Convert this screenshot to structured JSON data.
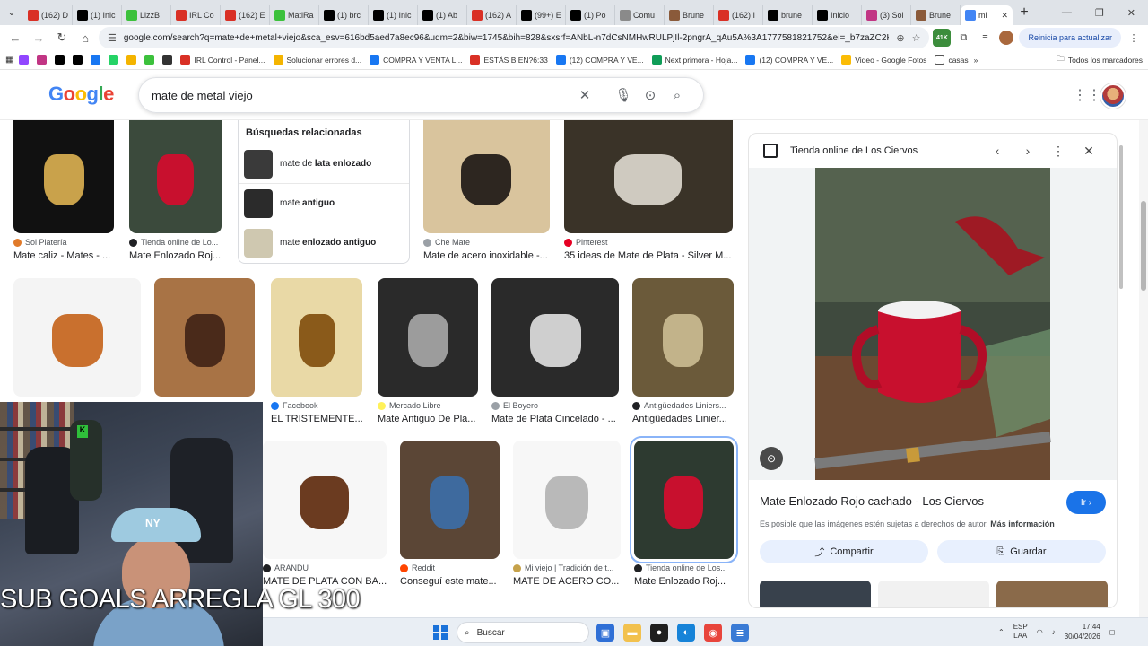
{
  "browser": {
    "tabs": [
      {
        "label": "(162) D",
        "color": "#d93025"
      },
      {
        "label": "(1) Inic",
        "color": "#000000"
      },
      {
        "label": "LizzB",
        "color": "#3cc13c"
      },
      {
        "label": "IRL Co",
        "color": "#d93025"
      },
      {
        "label": "(162) E",
        "color": "#d93025"
      },
      {
        "label": "MatiRa",
        "color": "#3cc13c"
      },
      {
        "label": "(1) brc",
        "color": "#000000"
      },
      {
        "label": "(1) Inic",
        "color": "#000000"
      },
      {
        "label": "(1) Ab",
        "color": "#000000"
      },
      {
        "label": "(162) A",
        "color": "#d93025"
      },
      {
        "label": "(99+) E",
        "color": "#000000"
      },
      {
        "label": "(1) Po",
        "color": "#000000"
      },
      {
        "label": "Comu",
        "color": "#8a8a8a"
      },
      {
        "label": "Brune",
        "color": "#8a5a3a"
      },
      {
        "label": "(162) I",
        "color": "#d93025"
      },
      {
        "label": "brune",
        "color": "#000000"
      },
      {
        "label": "Inicio",
        "color": "#000000"
      },
      {
        "label": "(3) Sol",
        "color": "#c13584"
      },
      {
        "label": "Brune",
        "color": "#8a5a3a"
      },
      {
        "label": "mi",
        "color": "#4285f4",
        "active": true
      }
    ],
    "new_tab": "+",
    "url": "google.com/search?q=mate+de+metal+viejo&sca_esv=616bd5aed7a8ec96&udm=2&biw=1745&bih=828&sxsrf=ANbL-n7dCsNMHwRULPjIl-2pngrA_qAu5A%3A1777581821752&ei=_b7zaZC2KeHd1sQPmbeY4...",
    "ext_badge": "41K",
    "update_button": "Reinicia para actualizar",
    "bookmarks": [
      {
        "label": "",
        "color": "#9146ff"
      },
      {
        "label": "",
        "color": "#c13584"
      },
      {
        "label": "",
        "color": "#000000"
      },
      {
        "label": "",
        "color": "#000000"
      },
      {
        "label": "",
        "color": "#1877f2"
      },
      {
        "label": "",
        "color": "#25d366"
      },
      {
        "label": "",
        "color": "#f4b400"
      },
      {
        "label": "",
        "color": "#3cc13c"
      },
      {
        "label": "",
        "color": "#333333"
      },
      {
        "label": "IRL Control - Panel...",
        "color": "#d93025"
      },
      {
        "label": "Solucionar errores d...",
        "color": "#f4b400"
      },
      {
        "label": "COMPRA Y VENTA L...",
        "color": "#1877f2"
      },
      {
        "label": "ESTÁS BIEN?6:33",
        "color": "#d93025"
      },
      {
        "label": "(12) COMPRA Y VE...",
        "color": "#1877f2"
      },
      {
        "label": "Next primora - Hoja...",
        "color": "#0f9d58"
      },
      {
        "label": "(12) COMPRA Y VE...",
        "color": "#1877f2"
      },
      {
        "label": "Video - Google Fotos",
        "color": "#fbbc05"
      },
      {
        "label": "casas",
        "color": "#ffffff"
      }
    ],
    "bookmarks_more": "»",
    "all_bookmarks": "Todos los marcadores"
  },
  "google": {
    "logo_letters": [
      "G",
      "o",
      "o",
      "g",
      "l",
      "e"
    ],
    "query": "mate de metal viejo"
  },
  "related": {
    "heading": "Búsquedas relacionadas",
    "items": [
      {
        "pre": "mate de ",
        "bold": "lata enlozado",
        "color": "#3a3a3a"
      },
      {
        "pre": "mate ",
        "bold": "antiguo",
        "color": "#2b2b2b"
      },
      {
        "pre": "mate ",
        "bold": "enlozado antiguo",
        "color": "#cfc8b0"
      }
    ]
  },
  "row1": [
    {
      "source": "Sol Platería",
      "title": "Mate caliz - Mates - ...",
      "bg": "#111111",
      "accent": "#c9a24b",
      "sfav": "#e07a2a"
    },
    {
      "source": "Tienda online de Lo...",
      "title": "Mate Enlozado Roj...",
      "bg": "#3b4a3c",
      "accent": "#c8102e",
      "sfav": "#202124"
    },
    {
      "source": "Che Mate",
      "title": "Mate de acero inoxidable -...",
      "bg": "#d9c49d",
      "accent": "#2d2620",
      "sfav": "#9aa0a6"
    },
    {
      "source": "Pinterest",
      "title": "35 ideas de Mate de Plata - Silver M...",
      "bg": "#3a3328",
      "accent": "#cfcac0",
      "sfav": "#e60023"
    }
  ],
  "row2": [
    {
      "source": "",
      "title": "",
      "bg": "#f4f4f4",
      "accent": "#c9702e",
      "sfav": ""
    },
    {
      "source": "",
      "title": "",
      "bg": "#a87345",
      "accent": "#4a2a1a",
      "sfav": ""
    },
    {
      "source": "Facebook",
      "title": "EL TRISTEMENTE...",
      "bg": "#e9d9a6",
      "accent": "#8a5a1a",
      "sfav": "#1877f2"
    },
    {
      "source": "Mercado Libre",
      "title": "Mate Antiguo De Pla...",
      "bg": "#2a2a2a",
      "accent": "#9c9c9c",
      "sfav": "#fff159"
    },
    {
      "source": "El Boyero",
      "title": "Mate de Plata Cincelado - ...",
      "bg": "#2a2a2a",
      "accent": "#cfcfcf",
      "sfav": "#9aa0a6"
    },
    {
      "source": "Antigüedades Liniers...",
      "title": "Antigüedades Linier...",
      "bg": "#6b5a3a",
      "accent": "#c2b38a",
      "sfav": "#202124"
    }
  ],
  "row3": [
    {
      "source": "ARANDU",
      "title": "MATE DE PLATA CON BA...",
      "bg": "#f7f7f7",
      "accent": "#6b3b20",
      "sfav": "#202124"
    },
    {
      "source": "Reddit",
      "title": "Conseguí este mate...",
      "bg": "#5b4636",
      "accent": "#3e6a9e",
      "sfav": "#ff4500"
    },
    {
      "source": "Mi viejo | Tradición de t...",
      "title": "MATE DE ACERO CO...",
      "bg": "#f7f7f7",
      "accent": "#b9b9b9",
      "sfav": "#c6a24b"
    },
    {
      "source": "Tienda online de Los...",
      "title": "Mate Enlozado Roj...",
      "bg": "#2d3a30",
      "accent": "#c8102e",
      "sfav": "#202124"
    }
  ],
  "panel": {
    "site": "Tienda online de Los Ciervos",
    "title": "Mate Enlozado Rojo cachado - Los Ciervos",
    "go_label": "Ir ›",
    "note": "Es posible que las imágenes estén sujetas a derechos de autor.",
    "note_link": "Más información",
    "share_label": "Compartir",
    "save_label": "Guardar"
  },
  "overlay": {
    "caption": "SUB GOALS ARREGLA GL   300",
    "cap_logo": "NY",
    "badge": "K"
  },
  "taskbar": {
    "search_label": "Buscar",
    "lang_top": "ESP",
    "lang_bottom": "LAA",
    "time": "17:44",
    "date": "30/04/2026"
  }
}
